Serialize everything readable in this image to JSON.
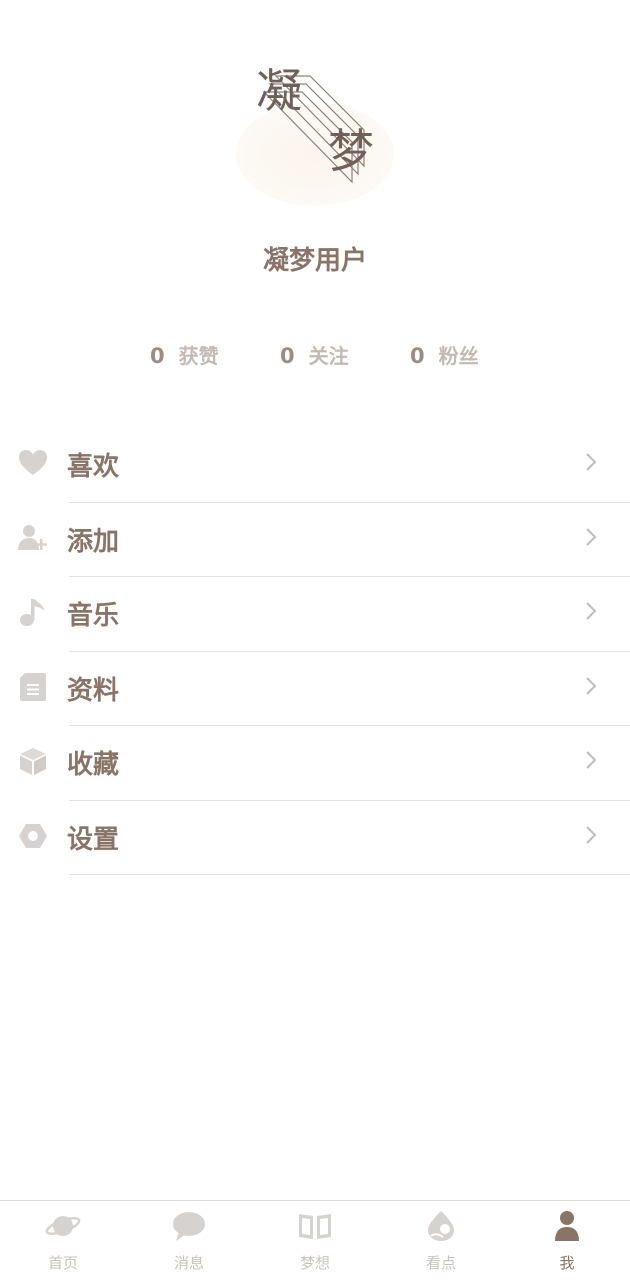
{
  "profile": {
    "logo_char_1": "凝",
    "logo_char_2": "梦",
    "username": "凝梦用户"
  },
  "stats": [
    {
      "value": "0",
      "label": "获赞"
    },
    {
      "value": "0",
      "label": "关注"
    },
    {
      "value": "0",
      "label": "粉丝"
    }
  ],
  "menu": [
    {
      "label": "喜欢",
      "icon": "heart-icon"
    },
    {
      "label": "添加",
      "icon": "add-user-icon"
    },
    {
      "label": "音乐",
      "icon": "music-note-icon"
    },
    {
      "label": "资料",
      "icon": "document-icon"
    },
    {
      "label": "收藏",
      "icon": "box-icon"
    },
    {
      "label": "设置",
      "icon": "settings-icon"
    }
  ],
  "tabs": [
    {
      "label": "首页",
      "icon": "planet-icon"
    },
    {
      "label": "消息",
      "icon": "chat-bubble-icon"
    },
    {
      "label": "梦想",
      "icon": "book-icon"
    },
    {
      "label": "看点",
      "icon": "drop-icon"
    },
    {
      "label": "我",
      "icon": "person-icon",
      "active": true
    }
  ],
  "colors": {
    "primary_text": "#8a7467",
    "muted_icon": "#d6d2cf",
    "stat_label": "#c4bab4",
    "tab_inactive": "#c9c3bf",
    "divider": "#e6e2df"
  }
}
